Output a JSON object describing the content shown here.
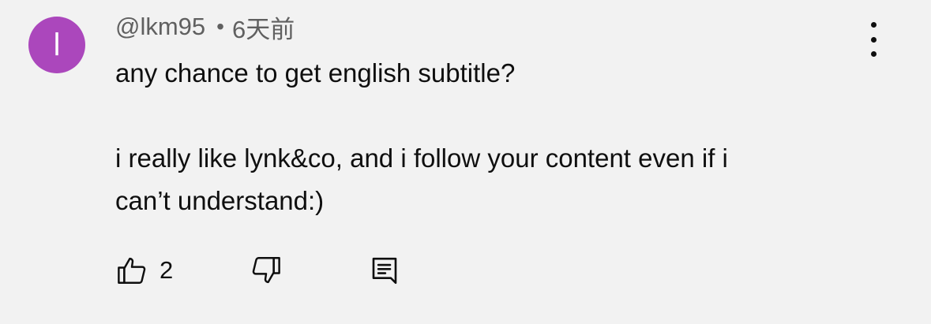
{
  "comment": {
    "avatar_letter": "l",
    "avatar_color": "#ab47bc",
    "author": "@lkm95",
    "separator": "•",
    "time": "6天前",
    "text_lines": [
      "any chance to get english subtitle?",
      "i really like lynk&co, and i follow your content even if i",
      "can’t understand:)"
    ]
  },
  "actions": {
    "like_icon": "thumbs-up-icon",
    "like_count": "2",
    "dislike_icon": "thumbs-down-icon",
    "reply_icon": "comment-reply-icon",
    "more_icon": "more-vertical-icon"
  }
}
